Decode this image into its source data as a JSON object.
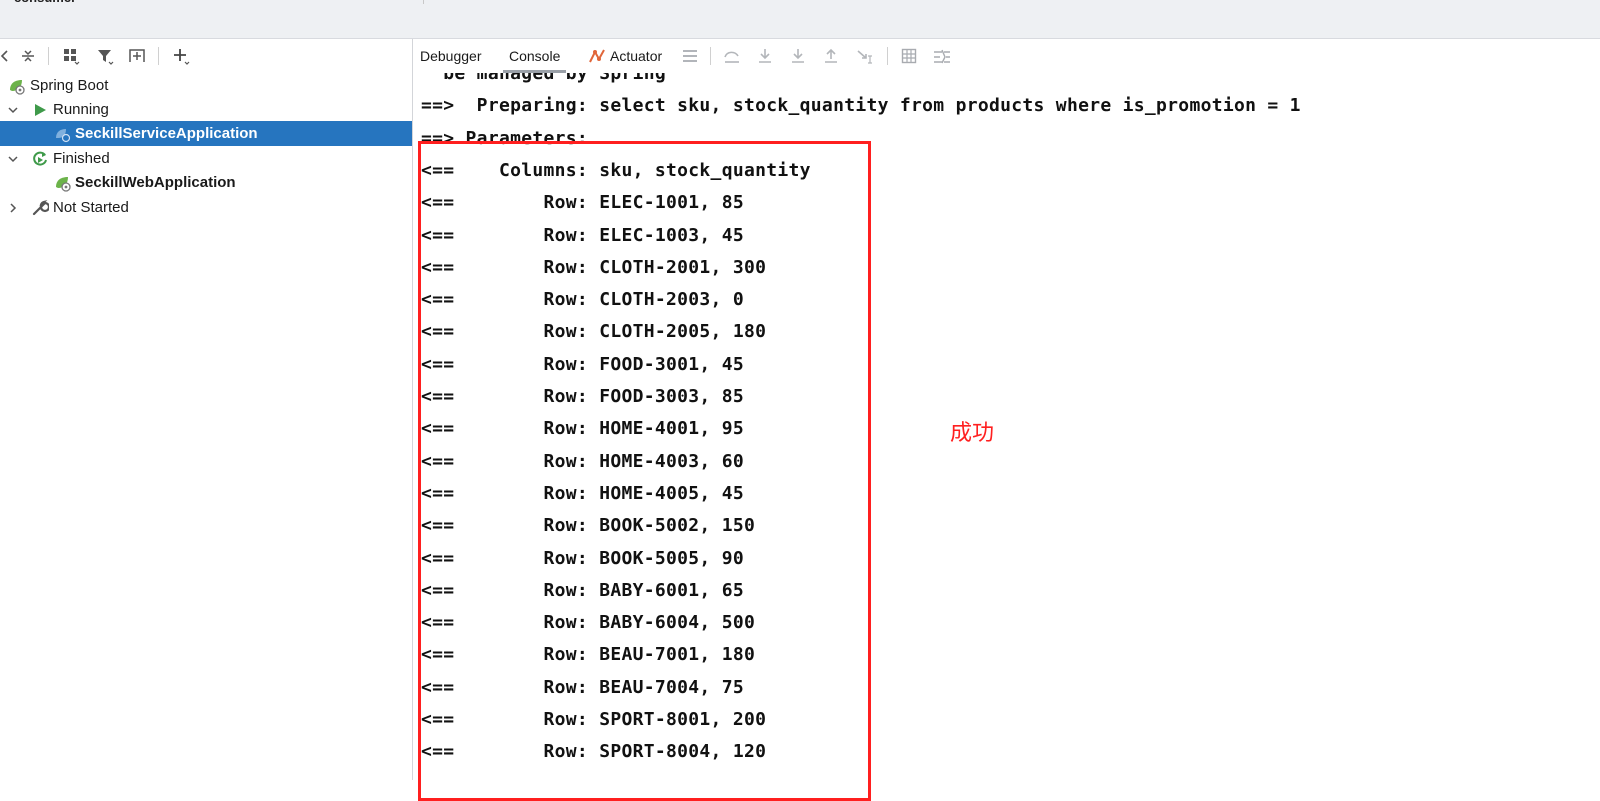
{
  "window": {
    "top_tab_partial": "consumer"
  },
  "left_panel": {
    "toolbar_icons": [
      "collapse-left-icon",
      "collapse-all-icon",
      "group-icon",
      "filter-icon",
      "add-config-icon",
      "add-icon"
    ],
    "tree": [
      {
        "label": "Spring Boot",
        "icon": "spring-boot-icon",
        "level": 0,
        "expanded": null
      },
      {
        "label": "Running",
        "icon": "run-icon",
        "level": 1,
        "expanded": true
      },
      {
        "label": "SeckillServiceApplication",
        "icon": "spring-app-icon",
        "level": 2,
        "selected": true
      },
      {
        "label": "Finished",
        "icon": "rerun-icon",
        "level": 1,
        "expanded": true
      },
      {
        "label": "SeckillWebApplication",
        "icon": "spring-app-icon",
        "level": 2
      },
      {
        "label": "Not Started",
        "icon": "wrench-icon",
        "level": 1,
        "expanded": false
      }
    ]
  },
  "right_panel": {
    "tabs": [
      {
        "label": "Debugger",
        "active": false
      },
      {
        "label": "Console",
        "active": true
      },
      {
        "label": "Actuator",
        "active": false,
        "icon": "actuator-icon"
      }
    ],
    "toolbar_icons": [
      "menu-icon",
      "step-over-icon",
      "step-into-icon",
      "force-step-into-icon",
      "step-out-icon",
      "run-to-cursor-icon",
      "evaluate-icon",
      "trace-icon"
    ],
    "console_lines": [
      "  be managed by Spring",
      "==>  Preparing: select sku, stock_quantity from products where is_promotion = 1",
      "==> Parameters: ",
      "<==    Columns: sku, stock_quantity",
      "<==        Row: ELEC-1001, 85",
      "<==        Row: ELEC-1003, 45",
      "<==        Row: CLOTH-2001, 300",
      "<==        Row: CLOTH-2003, 0",
      "<==        Row: CLOTH-2005, 180",
      "<==        Row: FOOD-3001, 45",
      "<==        Row: FOOD-3003, 85",
      "<==        Row: HOME-4001, 95",
      "<==        Row: HOME-4003, 60",
      "<==        Row: HOME-4005, 45",
      "<==        Row: BOOK-5002, 150",
      "<==        Row: BOOK-5005, 90",
      "<==        Row: BABY-6001, 65",
      "<==        Row: BABY-6004, 500",
      "<==        Row: BEAU-7001, 180",
      "<==        Row: BEAU-7004, 75",
      "<==        Row: SPORT-8001, 200",
      "<==        Row: SPORT-8004, 120"
    ]
  },
  "annotation": {
    "text": "成功",
    "color": "#ff2020"
  },
  "colors": {
    "selection": "#2675bf",
    "highlight_box": "#ff1f1f"
  }
}
